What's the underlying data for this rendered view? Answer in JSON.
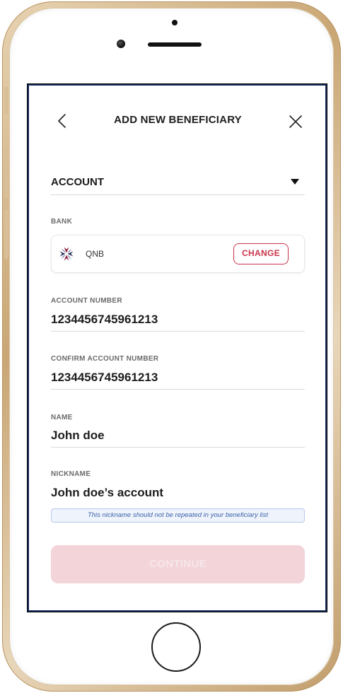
{
  "header": {
    "title": "ADD NEW BENEFICIARY"
  },
  "account_type": {
    "selected": "ACCOUNT"
  },
  "bank": {
    "label": "BANK",
    "name": "QNB",
    "change_label": "CHANGE"
  },
  "account_number": {
    "label": "ACCOUNT NUMBER",
    "value": "1234456745961213"
  },
  "confirm_account_number": {
    "label": "CONFIRM ACCOUNT NUMBER",
    "value": "1234456745961213"
  },
  "name": {
    "label": "NAME",
    "value": "John doe"
  },
  "nickname": {
    "label": "NICKNAME",
    "value": "John doe’s account",
    "hint": "This nickname should not be repeated in your beneficiary list"
  },
  "continue_button": {
    "label": "CONTINUE"
  },
  "icons": {
    "back": "chevron-left-icon",
    "close": "close-icon",
    "dropdown": "caret-down-icon",
    "bank_logo": "qnb-logo-icon"
  },
  "colors": {
    "accent": "#c8344a",
    "continue_disabled_bg": "#f2d4d9",
    "hint_bg": "#eef3fc",
    "hint_text": "#3f63a8",
    "screen_border": "#162a5a"
  }
}
